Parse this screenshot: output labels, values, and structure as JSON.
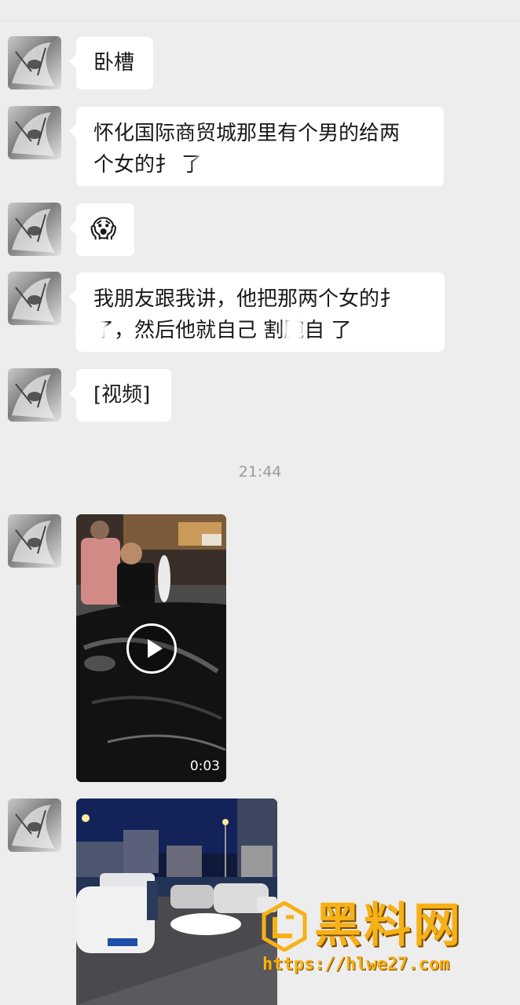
{
  "messages": [
    {
      "type": "text",
      "lines": [
        "卧槽"
      ]
    },
    {
      "type": "text",
      "lines": [
        "怀化国际商贸城那里有个男的给两",
        "个女的扌   了"
      ]
    },
    {
      "type": "emoji",
      "emoji": "😱"
    },
    {
      "type": "text",
      "lines": [
        "我朋友跟我讲，他把那两个女的扌",
        "   了，然后他就自己 割腕自 了"
      ]
    },
    {
      "type": "text",
      "lines": [
        "[视频]"
      ]
    }
  ],
  "timestamp": "21:44",
  "videos": [
    {
      "duration": "0:03",
      "has_play_button": true
    },
    {
      "duration": "",
      "has_play_button": false
    }
  ],
  "watermark": {
    "name": "黑料网",
    "url": "https://hlwe27.com"
  },
  "colors": {
    "background": "#ededed",
    "bubble": "#ffffff",
    "watermark": "#f6b116"
  }
}
